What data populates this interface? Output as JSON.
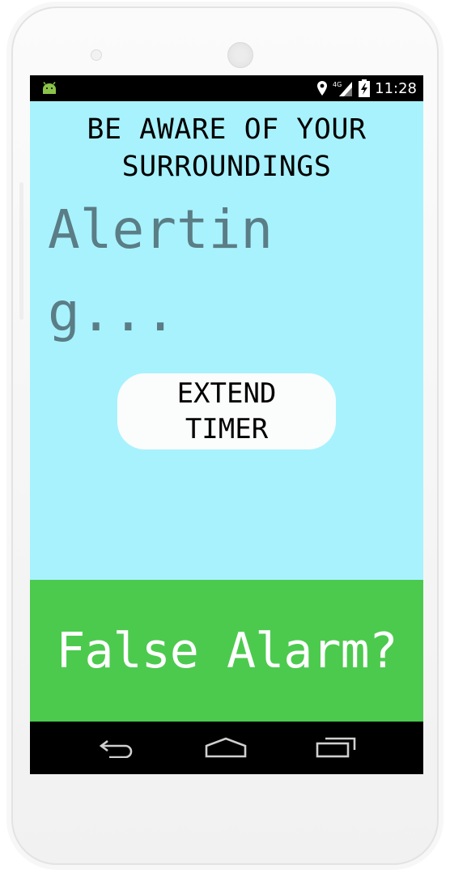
{
  "status_bar": {
    "time": "11:28",
    "network_label": "4G",
    "icons": [
      "android-notification-icon",
      "location-icon",
      "signal-icon",
      "battery-charging-icon"
    ]
  },
  "app": {
    "warning_text": "BE AWARE OF YOUR SURROUNDINGS",
    "status_text": "Alerting...",
    "extend_button_label": "EXTEND TIMER",
    "false_alarm_label": "False Alarm?"
  },
  "nav_bar": {
    "icons": [
      "back-icon",
      "home-icon",
      "recent-apps-icon"
    ]
  },
  "colors": {
    "app_background": "#a8f2fd",
    "false_alarm_background": "#4cca4e",
    "status_text": "#5a7d86",
    "button_background": "#fbfcfc"
  }
}
